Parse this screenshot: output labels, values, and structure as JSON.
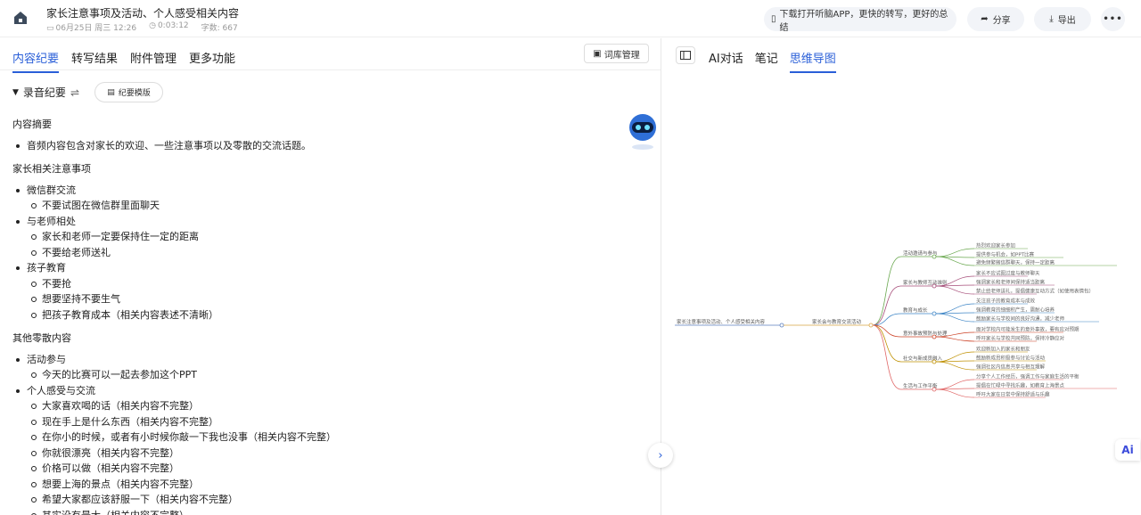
{
  "header": {
    "title": "家长注意事项及活动、个人感受相关内容",
    "date": "06月25日 周三 12:26",
    "duration": "0:03:12",
    "word_count": "字数: 667",
    "app_promo": "下载打开听脑APP，更快的转写，更好的总结",
    "share_label": "分享",
    "export_label": "导出",
    "more_label": "•••"
  },
  "left": {
    "tabs": [
      "内容纪要",
      "转写结果",
      "附件管理",
      "更多功能"
    ],
    "lexicon_label": "词库管理",
    "section_title": "录音纪要",
    "template_label": "纪要模版",
    "summary": {
      "title": "内容摘要",
      "items": [
        "音频内容包含对家长的欢迎、一些注意事项以及零散的交流话题。"
      ]
    },
    "parents": {
      "title": "家长相关注意事项",
      "groups": [
        {
          "label": "微信群交流",
          "children": [
            "不要试图在微信群里面聊天"
          ]
        },
        {
          "label": "与老师相处",
          "children": [
            "家长和老师一定要保持住一定的距离",
            "不要给老师送礼"
          ]
        },
        {
          "label": "孩子教育",
          "children": [
            "不要抢",
            "想要坚持不要生气",
            "把孩子教育成本（相关内容表述不清晰）"
          ]
        }
      ]
    },
    "misc": {
      "title": "其他零散内容",
      "groups": [
        {
          "label": "活动参与",
          "children": [
            "今天的比赛可以一起去参加这个PPT"
          ]
        },
        {
          "label": "个人感受与交流",
          "children": [
            "大家喜欢喝的话（相关内容不完整）",
            "现在手上是什么东西（相关内容不完整）",
            "在你小的时候，或者有小时候你敲一下我也没事（相关内容不完整）",
            "你就很漂亮（相关内容不完整）",
            "价格可以做（相关内容不完整）",
            "想要上海的景点（相关内容不完整）",
            "希望大家都应该舒服一下（相关内容不完整）",
            "其实没有最大（相关内容不完整）"
          ]
        }
      ]
    }
  },
  "right": {
    "tabs": [
      "AI对话",
      "笔记",
      "思维导图"
    ],
    "mindmap": {
      "root": "家长注意事项及活动、个人感受相关内容",
      "center": "家长会与教育交流活动",
      "branches": [
        {
          "label": "活动邀请与参与",
          "color": "#6aa84f",
          "children": [
            "热烈欢迎家长参加",
            "提供参与机会，如PPT比赛",
            "避免频繁微信群聊天，保持一定距离"
          ]
        },
        {
          "label": "家长与教师互动准则",
          "color": "#a64d79",
          "children": [
            "家长不应试图过度与教师聊天",
            "强调家长和老师间保持适当距离",
            "禁止给老师送礼，提倡健康互动方式（如使用表情包）"
          ]
        },
        {
          "label": "教育与成长",
          "color": "#3d85c6",
          "children": [
            "关注孩子的教育成本与成效",
            "强调教育的细细积产生，需耐心培养",
            "鼓励家长与学校间的良好沟通，减少老师"
          ]
        },
        {
          "label": "意外事故预防与处理",
          "color": "#cc4125",
          "children": [
            "面对学校内可能发生的意外事故，要有应对预期",
            "呼吁家长与学校共同预防，保持冷静应对"
          ]
        },
        {
          "label": "社交与新成员融入",
          "color": "#bf9000",
          "children": [
            "欢迎新加入的家长和朋友",
            "鼓励新成员积极参与讨论与活动",
            "强调社区内信息共享与相互理解"
          ]
        },
        {
          "label": "生活与工作平衡",
          "color": "#e06666",
          "children": [
            "分享个人工作经历，强调工作与家庭生活的平衡",
            "提倡在忙碌中寻找乐趣，如教育上海景点",
            "呼吁大家在日常中保持舒适与乐趣"
          ]
        }
      ]
    }
  },
  "ai_label": "Ai"
}
